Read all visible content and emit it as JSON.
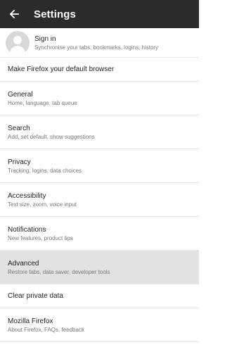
{
  "toolbar": {
    "back_icon": "arrow-left-icon",
    "title": "Settings",
    "background": "#2b2b2e"
  },
  "account": {
    "icon": "avatar-icon",
    "title": "Sign in",
    "summary": "Synchronise your tabs, bookmarks, logins, history"
  },
  "items": [
    {
      "title": "Make Firefox your default browser",
      "summary": ""
    },
    {
      "title": "General",
      "summary": "Home, language, tab queue"
    },
    {
      "title": "Search",
      "summary": "Add, set default, show suggestions"
    },
    {
      "title": "Privacy",
      "summary": "Tracking, logins, data choices"
    },
    {
      "title": "Accessibility",
      "summary": "Text size, zoom, voice input"
    },
    {
      "title": "Notifications",
      "summary": "New features, product tips"
    },
    {
      "title": "Advanced",
      "summary": "Restore tabs, data saver, developer tools",
      "highlighted": true
    },
    {
      "title": "Clear private data",
      "summary": ""
    },
    {
      "title": "Mozilla Firefox",
      "summary": "About Firefox, FAQs, feedback"
    }
  ]
}
